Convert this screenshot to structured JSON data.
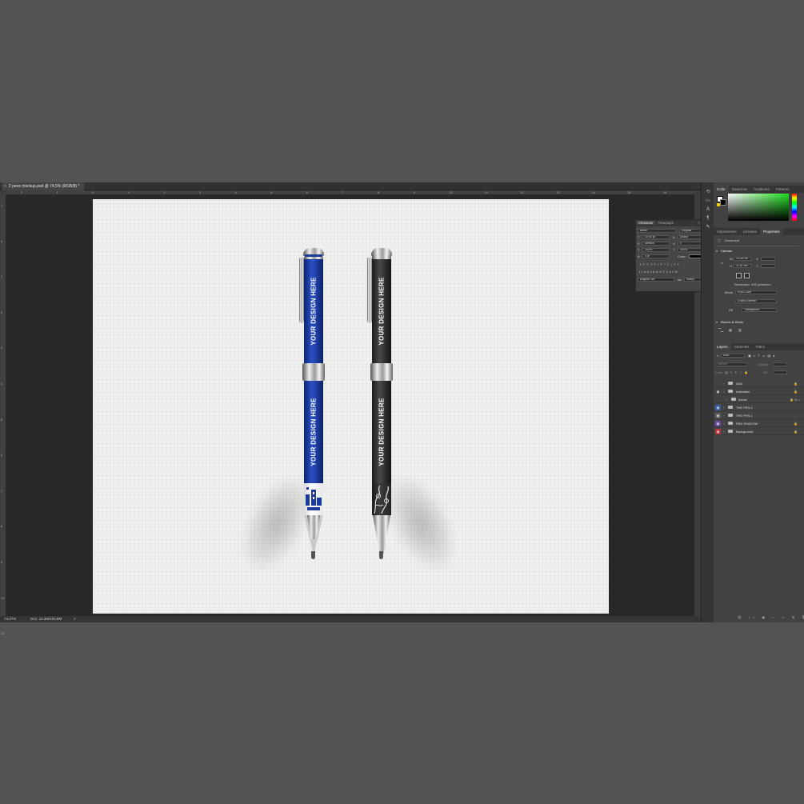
{
  "document_tab": {
    "title": "2 pens mockup.psd @ 74,5% (RGB/8) *",
    "close": "×"
  },
  "ruler": {
    "top_ticks": [
      "2",
      "1",
      "0",
      "1",
      "2",
      "3",
      "4",
      "5",
      "6",
      "7",
      "8",
      "9",
      "10",
      "11",
      "12",
      "13",
      "14",
      "15",
      "16"
    ],
    "left_ticks": [
      "1",
      "0",
      "1",
      "2",
      "3",
      "4",
      "5",
      "6",
      "7",
      "8",
      "9",
      "10",
      "11"
    ]
  },
  "status": {
    "zoom": "74,47%",
    "doc": "Doc: 43,3M/225,8M",
    "arrow": ">"
  },
  "pens": [
    {
      "name": "blue pen",
      "color": "#1b3a9c",
      "text_top": "YOUR DESIGN HERE",
      "text_bottom": "YOUR DESIGN HERE",
      "grip": "geometric"
    },
    {
      "name": "black pen",
      "color": "#2e2e30",
      "text_top": "YOUR DESIGN HERE",
      "text_bottom": "YOUR DESIGN HERE",
      "grip": "floral"
    }
  ],
  "character_panel": {
    "tabs": [
      "Character",
      "Paragraph"
    ],
    "font_family": "Anton",
    "font_style": "Regular",
    "size": "10,92 pt",
    "leading": "(Auto)",
    "kerning": "Metrics",
    "tracking": "0",
    "vscale": "100%",
    "hscale": "100%",
    "baseline": "0 pt",
    "color_label": "Color:",
    "language": "English: UK",
    "aa_label": "aa",
    "antialias": "Sharp",
    "style_buttons": [
      "T",
      "T",
      "TT",
      "Tt",
      "T¹",
      "T₁",
      "T",
      "T"
    ],
    "ot_buttons": [
      "fi",
      "ơ",
      "st",
      "A",
      "ad",
      "T",
      "1st",
      "½"
    ]
  },
  "color_panel": {
    "tabs": [
      "Color",
      "Swatches",
      "Gradients",
      "Patterns"
    ],
    "fg": "#ffffff",
    "bg": "#000000",
    "accent": "#3ccf2a"
  },
  "properties_panel": {
    "tabs": [
      "Adjustments",
      "Libraries",
      "Properties"
    ],
    "document_label": "Document",
    "canvas_header": "Canvas",
    "w_label": "W",
    "w_value": "14,46 cm",
    "h_label": "H",
    "h_value": "11,62 cm",
    "x_label": "X",
    "y_label": "Y",
    "resolution": "Resolution: 300 pixels/cm",
    "mode_label": "Mode",
    "mode_value": "RGB Color",
    "depth_value": "8 Bits/Channel",
    "fill_label": "Fill",
    "fill_value": "Transparent",
    "rulers_header": "Rulers & Grids"
  },
  "layers_panel": {
    "tabs": [
      "Layers",
      "Channels",
      "Paths"
    ],
    "kind_label": "Kind",
    "blend_mode": "Normal",
    "opacity_label": "Opacity:",
    "lock_label": "Lock:",
    "fill_label": "Fill:",
    "layers": [
      {
        "name": "ADS",
        "visible": false,
        "eye_color": "",
        "indent": 0
      },
      {
        "name": "Indication",
        "visible": true,
        "eye_color": "",
        "indent": 0
      },
      {
        "name": "Arrow",
        "visible": false,
        "eye_color": "",
        "indent": 1
      },
      {
        "name": "THE PEN 2",
        "visible": true,
        "eye_color": "#3a5fa8",
        "indent": 0
      },
      {
        "name": "THE PEN 1",
        "visible": true,
        "eye_color": "#5b5b5b",
        "indent": 0
      },
      {
        "name": "PEN SHADOW",
        "visible": true,
        "eye_color": "#6a4aa0",
        "indent": 0
      },
      {
        "name": "Background",
        "visible": true,
        "eye_color": "#b8333a",
        "indent": 0
      }
    ]
  }
}
